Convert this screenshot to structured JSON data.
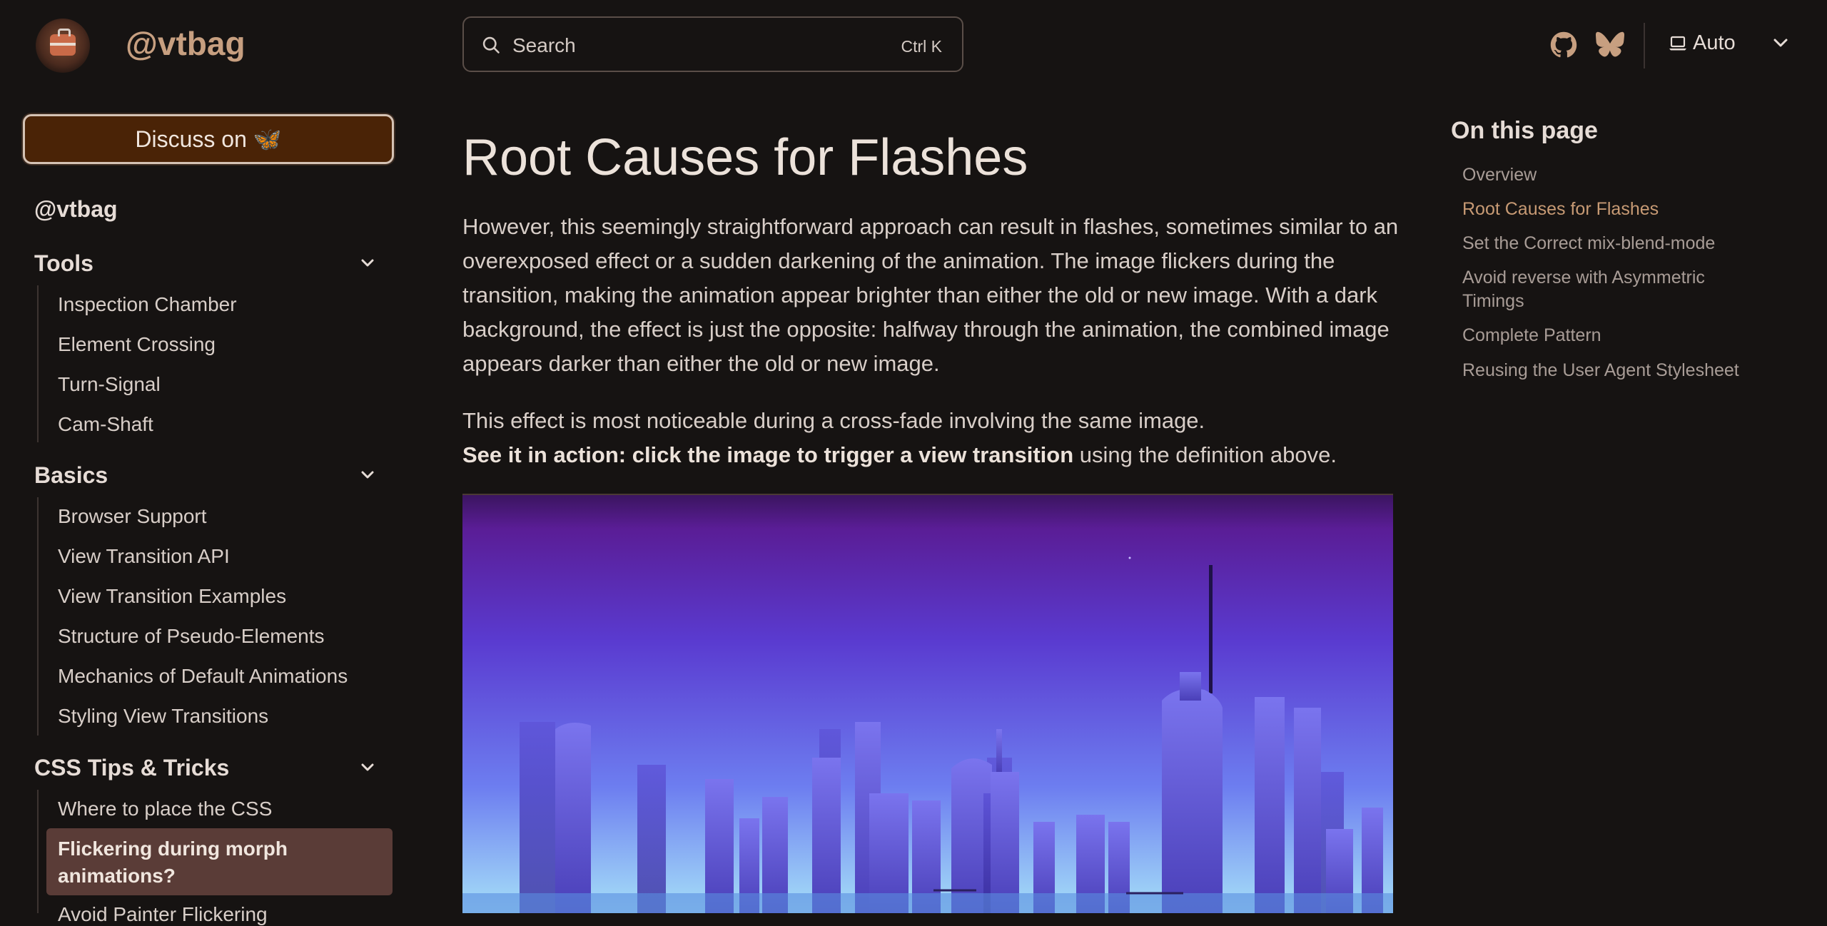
{
  "header": {
    "site_title": "@vtbag",
    "search_label": "Search",
    "search_shortcut": "Ctrl K",
    "theme_label": "Auto",
    "icons": [
      "github-icon",
      "butterfly-icon",
      "laptop-icon",
      "chevron-down-icon"
    ]
  },
  "sidebar": {
    "discuss_label": "Discuss on 🦋",
    "top_link": "@vtbag",
    "groups": [
      {
        "title": "Tools",
        "items": [
          "Inspection Chamber",
          "Element Crossing",
          "Turn-Signal",
          "Cam-Shaft"
        ]
      },
      {
        "title": "Basics",
        "items": [
          "Browser Support",
          "View Transition API",
          "View Transition Examples",
          "Structure of Pseudo-Elements",
          "Mechanics of Default Animations",
          "Styling View Transitions"
        ]
      },
      {
        "title": "CSS Tips & Tricks",
        "items": [
          "Where to place the CSS",
          "Flickering during morph animations?",
          "Avoid Painter Flickering"
        ]
      }
    ]
  },
  "main": {
    "heading": "Root Causes for Flashes",
    "paragraph1": "However, this seemingly straightforward approach can result in flashes, sometimes similar to an overexposed effect or a sudden darkening of the animation. The image flickers during the transition, making the animation appear brighter than either the old or new image. With a dark background, the effect is just the opposite: halfway through the animation, the com­bined image appears darker than either the old or new image.",
    "paragraph2_line1": "This effect is most noticeable during a cross-fade involving the same image.",
    "paragraph2_bold": "See it in action: click the image to trigger a view transition",
    "paragraph2_rest": " using the definition above."
  },
  "toc": {
    "title": "On this page",
    "items": [
      "Overview",
      "Root Causes for Flashes",
      "Set the Correct mix-blend-mode",
      "Avoid reverse with Asymmetric Timings",
      "Complete Pattern",
      "Reusing the User Agent Stylesheet"
    ],
    "active_index": 1
  },
  "colors": {
    "background": "#161312",
    "accent": "#c79f80",
    "active_nav": "#5a3c37",
    "discuss_bg": "#4a2306"
  }
}
